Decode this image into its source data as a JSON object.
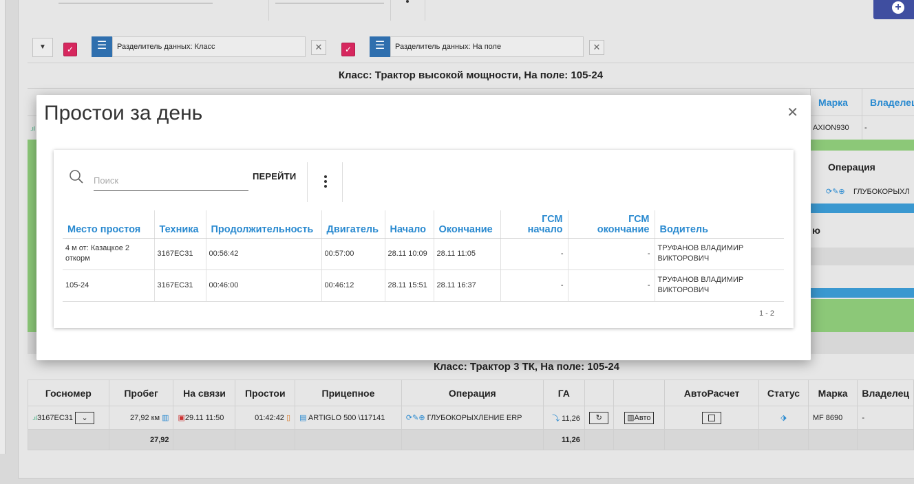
{
  "toolbar": {
    "add_label": "+",
    "filters": [
      {
        "label": "Разделитель данных: Класс"
      },
      {
        "label": "Разделитель данных: На поле"
      }
    ]
  },
  "groups": [
    {
      "title": "Класс: Трактор высокой мощности, На поле: 105-24"
    },
    {
      "title": "Класс: Трактор 3 ТК, На поле: 105-24"
    }
  ],
  "bg_top": {
    "headers": {
      "marka": "Марка",
      "owner": "Владелец"
    },
    "row": {
      "marka": "AXION930",
      "owner": "-"
    },
    "operation_header": "Операция",
    "operation_value": "ГЛУБОКОРЫХЛ",
    "side_text": "ю"
  },
  "bg_table2": {
    "headers": [
      "Госномер",
      "Пробег",
      "На связи",
      "Простои",
      "Прицепное",
      "Операция",
      "ГА",
      "",
      "",
      "АвтоРасчет",
      "Статус",
      "Марка",
      "Владелец"
    ],
    "row": {
      "gosnomer": "3167ЕС31",
      "probeg": "27,92 км",
      "na_svyazi": "29.11 11:50",
      "prostoi": "01:42:42",
      "pricepnoe": "ARTIGLO 500 \\117141",
      "operation": "ГЛУБОКОРЫХЛЕНИЕ ERP",
      "ga": "11,26",
      "auto_btn": "Авто",
      "marka": "MF 8690",
      "owner": "-"
    },
    "totals": {
      "probeg": "27,92",
      "ga": "11,26"
    }
  },
  "modal": {
    "title": "Простои за день",
    "search_placeholder": "Поиск",
    "search_value": "",
    "goto_label": "ПЕРЕЙТИ",
    "columns": [
      "Место простоя",
      "Техника",
      "Продолжительность",
      "Двигатель",
      "Начало",
      "Окончание",
      "ГСМ начало",
      "ГСМ окончание",
      "Водитель"
    ],
    "rows": [
      {
        "place": "4 м от: Казацкое 2 откорм",
        "tech": "3167ЕС31",
        "duration": "00:56:42",
        "engine": "00:57:00",
        "start": "28.11 10:09",
        "end": "28.11 11:05",
        "gsm_start": "-",
        "gsm_end": "-",
        "driver": "ТРУФАНОВ ВЛАДИМИР ВИКТОРОВИЧ"
      },
      {
        "place": "105-24",
        "tech": "3167ЕС31",
        "duration": "00:46:00",
        "engine": "00:46:12",
        "start": "28.11 15:51",
        "end": "28.11 16:37",
        "gsm_start": "-",
        "gsm_end": "-",
        "driver": "ТРУФАНОВ ВЛАДИМИР ВИКТОРОВИЧ"
      }
    ],
    "pager": "1 - 2"
  },
  "colors": {
    "accent": "#2a8ad0",
    "checkbox": "#d6275e",
    "chip_icon": "#2f6fae",
    "green_row": "#8cc878",
    "blue_row": "#3a98d0",
    "add_button": "#3f4ea0"
  }
}
